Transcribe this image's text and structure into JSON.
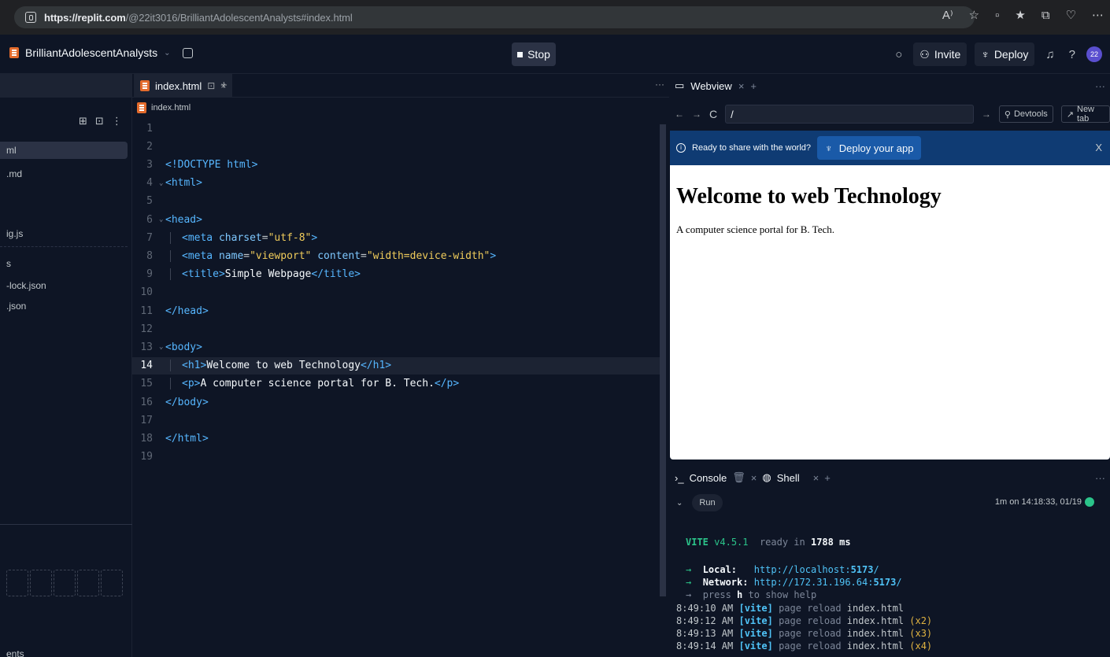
{
  "browser": {
    "url_host": "https://replit.com",
    "url_path": "/@22it3016/BrilliantAdolescentAnalysts#index.html",
    "action_icons": [
      "A⁾",
      "☆",
      "▫",
      "★",
      "⧉",
      "♡",
      "⋯"
    ]
  },
  "header": {
    "repl_name": "BrilliantAdolescentAnalysts",
    "stop_label": "Stop",
    "invite_label": "Invite",
    "deploy_label": "Deploy",
    "help_label": "?",
    "avatar_text": "22"
  },
  "sidebar": {
    "files": [
      {
        "label": "ml",
        "active": true
      },
      {
        "label": ".md",
        "active": false
      },
      {
        "label": "ig.js",
        "active": false
      },
      {
        "label": "s",
        "active": false
      },
      {
        "label": "-lock.json",
        "active": false
      },
      {
        "label": ".json",
        "active": false
      }
    ],
    "bottom_label": "ents"
  },
  "editor": {
    "tab_label": "index.html",
    "breadcrumb": "index.html",
    "current_line": 14,
    "lines": [
      {
        "n": "1",
        "parts": []
      },
      {
        "n": "2",
        "parts": []
      },
      {
        "n": "3",
        "parts": [
          [
            "tag",
            "<!DOCTYPE html>"
          ]
        ]
      },
      {
        "n": "4",
        "fold": true,
        "parts": [
          [
            "tag",
            "<html>"
          ]
        ]
      },
      {
        "n": "5",
        "parts": []
      },
      {
        "n": "6",
        "fold": true,
        "parts": [
          [
            "tag",
            "<head>"
          ]
        ]
      },
      {
        "n": "7",
        "indent": true,
        "parts": [
          [
            "tag",
            "<meta"
          ],
          [
            "attr",
            " charset"
          ],
          [
            "code",
            "="
          ],
          [
            "str",
            "\"utf-8\""
          ],
          [
            "tag",
            ">"
          ]
        ]
      },
      {
        "n": "8",
        "indent": true,
        "parts": [
          [
            "tag",
            "<meta"
          ],
          [
            "attr",
            " name"
          ],
          [
            "code",
            "="
          ],
          [
            "str",
            "\"viewport\""
          ],
          [
            "attr",
            " content"
          ],
          [
            "code",
            "="
          ],
          [
            "str",
            "\"width=device-width\""
          ],
          [
            "tag",
            ">"
          ]
        ]
      },
      {
        "n": "9",
        "indent": true,
        "parts": [
          [
            "tag",
            "<title>"
          ],
          [
            "txt",
            "Simple Webpage"
          ],
          [
            "tag",
            "</title>"
          ]
        ]
      },
      {
        "n": "10",
        "indent": true,
        "parts": []
      },
      {
        "n": "11",
        "parts": [
          [
            "tag",
            "</head>"
          ]
        ]
      },
      {
        "n": "12",
        "parts": []
      },
      {
        "n": "13",
        "fold": true,
        "parts": [
          [
            "tag",
            "<body>"
          ]
        ]
      },
      {
        "n": "14",
        "indent": true,
        "parts": [
          [
            "tag",
            "<h1>"
          ],
          [
            "txt",
            "Welcome to web Technology"
          ],
          [
            "tag",
            "</h1>"
          ]
        ]
      },
      {
        "n": "15",
        "indent": true,
        "parts": [
          [
            "tag",
            "<p>"
          ],
          [
            "txt",
            "A computer science portal for B. Tech."
          ],
          [
            "tag",
            "</p>"
          ]
        ]
      },
      {
        "n": "16",
        "parts": [
          [
            "tag",
            "</body>"
          ]
        ]
      },
      {
        "n": "17",
        "parts": []
      },
      {
        "n": "18",
        "parts": [
          [
            "tag",
            "</html>"
          ]
        ]
      },
      {
        "n": "19",
        "parts": []
      }
    ]
  },
  "webview": {
    "tab_label": "Webview",
    "url_value": "/",
    "devtools_label": "Devtools",
    "new_tab_label": "New tab",
    "banner_text": "Ready to share with the world?",
    "deploy_app_label": "Deploy your app",
    "page_heading": "Welcome to web Technology",
    "page_paragraph": "A computer science portal for B. Tech."
  },
  "console": {
    "console_tab_label": "Console",
    "shell_tab_label": "Shell",
    "run_label": "Run",
    "run_status": "1m on 14:18:33, 01/19",
    "vite_name": "VITE",
    "vite_version": "v4.5.1",
    "vite_ready": "ready in",
    "vite_time": "1788",
    "vite_unit": "ms",
    "local_label": "Local:",
    "local_url_prefix": "http://localhost:",
    "local_port": "5173",
    "local_url_suffix": "/",
    "network_label": "Network:",
    "network_url_prefix": "http://172.31.196.64:",
    "network_port": "5173",
    "network_url_suffix": "/",
    "help_prefix": "press",
    "help_key": "h",
    "help_suffix": "to show help",
    "logs": [
      {
        "time": "8:49:10 AM",
        "tag": "[vite]",
        "msg": "page reload",
        "file": "index.html",
        "count": ""
      },
      {
        "time": "8:49:12 AM",
        "tag": "[vite]",
        "msg": "page reload",
        "file": "index.html",
        "count": "(x2)"
      },
      {
        "time": "8:49:13 AM",
        "tag": "[vite]",
        "msg": "page reload",
        "file": "index.html",
        "count": "(x3)"
      },
      {
        "time": "8:49:14 AM",
        "tag": "[vite]",
        "msg": "page reload",
        "file": "index.html",
        "count": "(x4)"
      }
    ]
  }
}
